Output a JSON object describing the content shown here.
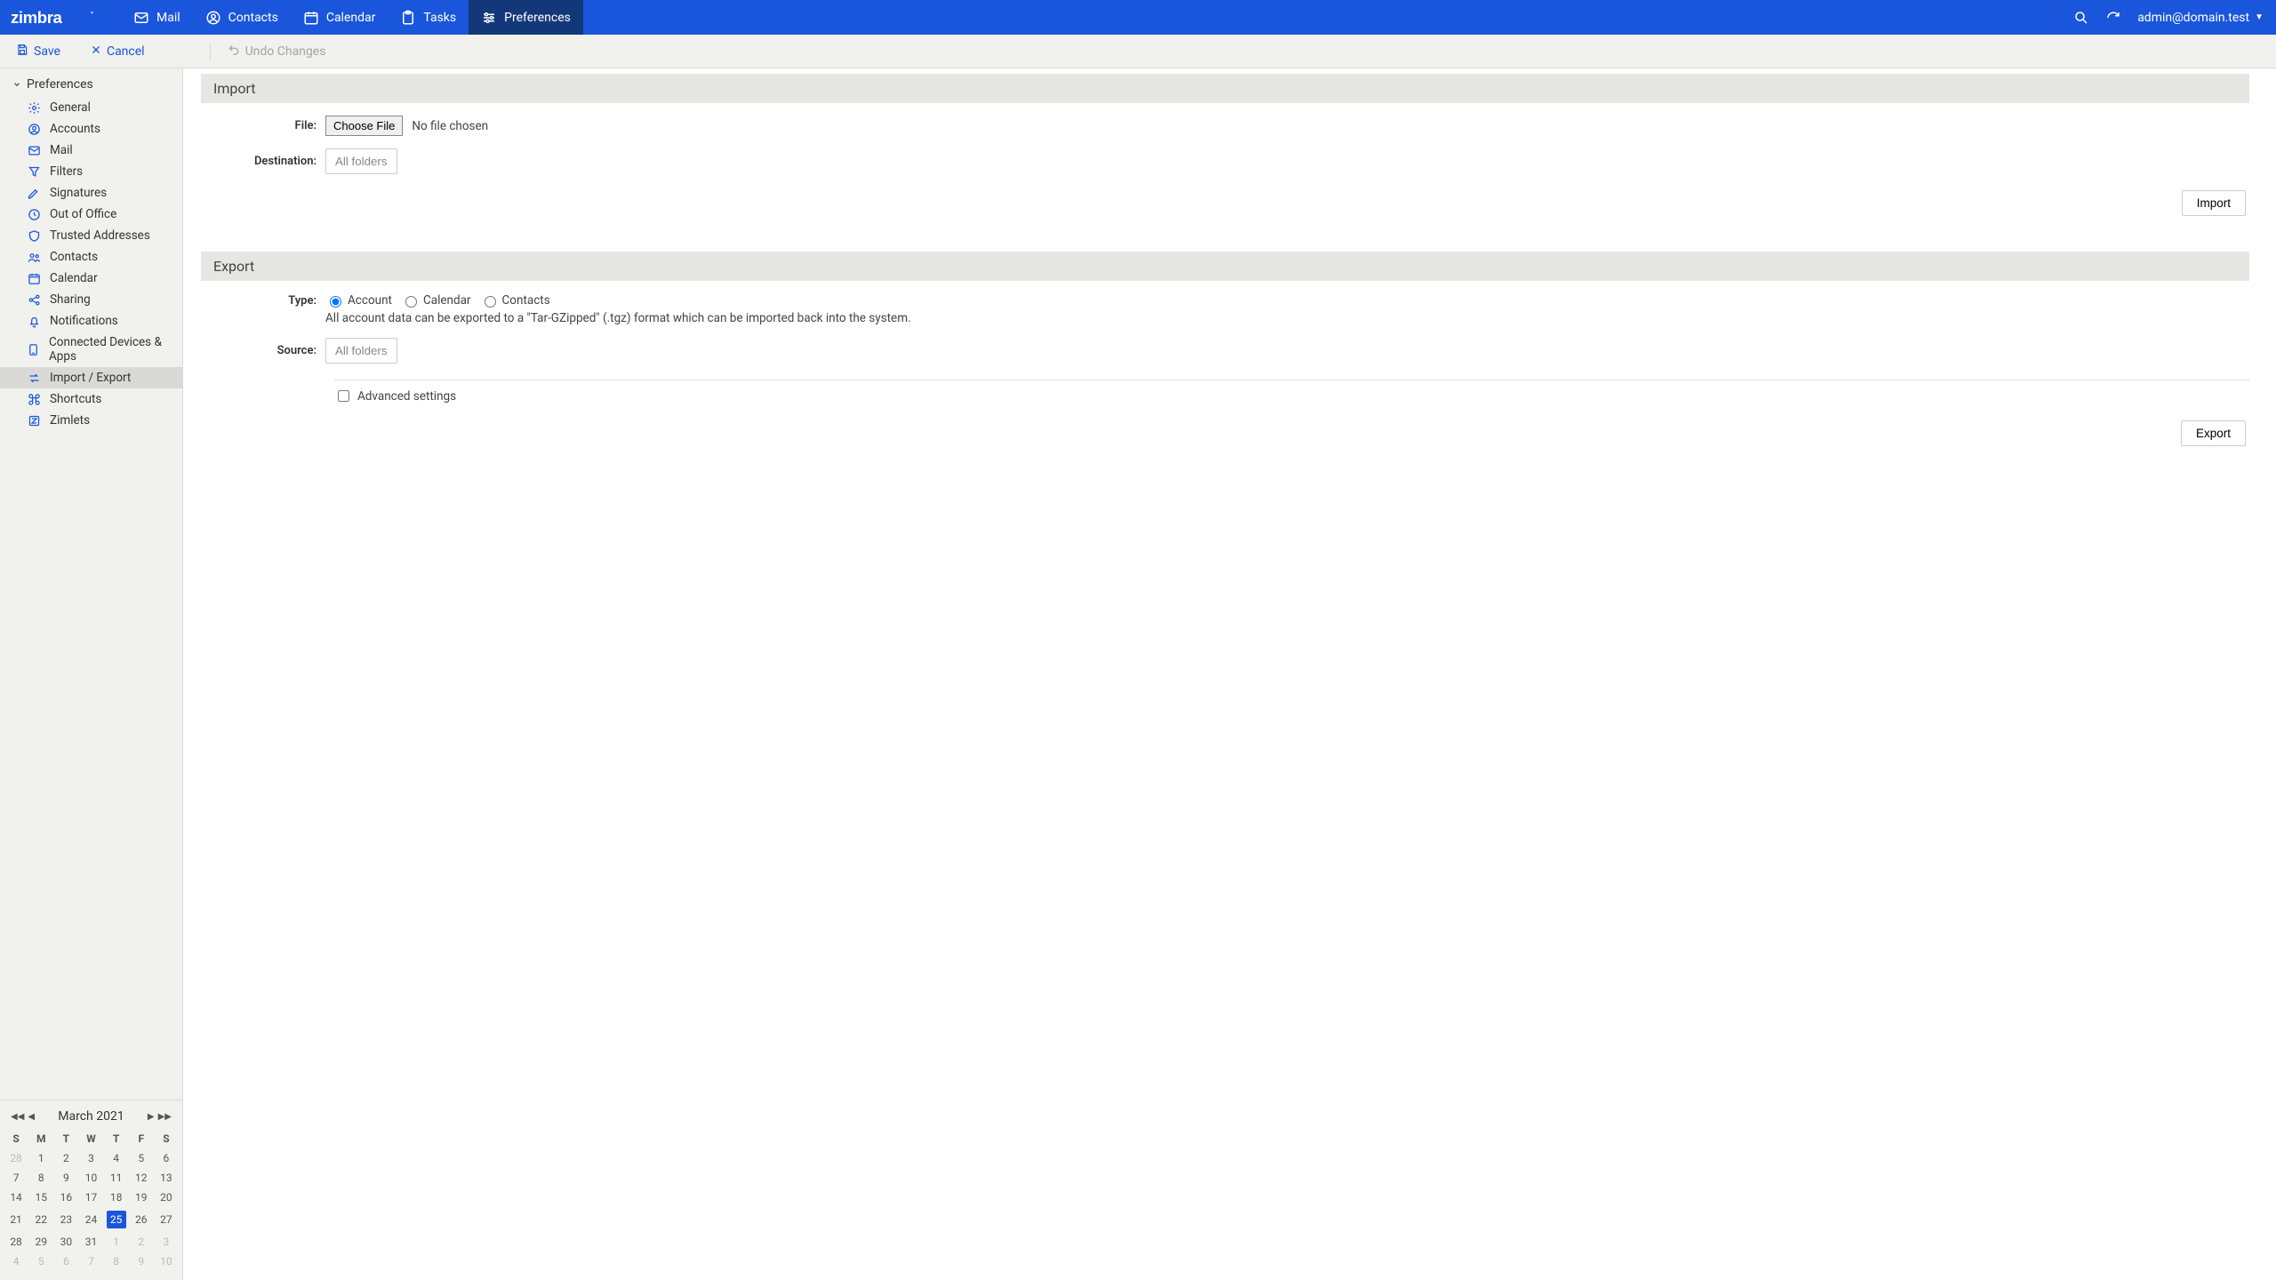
{
  "brand": "zimbra",
  "user": "admin@domain.test",
  "topbar_tabs": {
    "mail": "Mail",
    "contacts": "Contacts",
    "calendar": "Calendar",
    "tasks": "Tasks",
    "preferences": "Preferences"
  },
  "toolbar": {
    "save": "Save",
    "cancel": "Cancel",
    "undo": "Undo Changes"
  },
  "sidebar": {
    "header": "Preferences",
    "items": {
      "general": "General",
      "accounts": "Accounts",
      "mail": "Mail",
      "filters": "Filters",
      "signatures": "Signatures",
      "outofoffice": "Out of Office",
      "trusted": "Trusted Addresses",
      "contacts": "Contacts",
      "calendar": "Calendar",
      "sharing": "Sharing",
      "notifications": "Notifications",
      "devices": "Connected Devices & Apps",
      "importexport": "Import / Export",
      "shortcuts": "Shortcuts",
      "zimlets": "Zimlets"
    }
  },
  "minical": {
    "title": "March 2021",
    "dow": [
      "S",
      "M",
      "T",
      "W",
      "T",
      "F",
      "S"
    ],
    "weeks": [
      [
        {
          "d": "28",
          "o": true
        },
        {
          "d": "1"
        },
        {
          "d": "2"
        },
        {
          "d": "3"
        },
        {
          "d": "4"
        },
        {
          "d": "5"
        },
        {
          "d": "6"
        }
      ],
      [
        {
          "d": "7"
        },
        {
          "d": "8"
        },
        {
          "d": "9"
        },
        {
          "d": "10"
        },
        {
          "d": "11"
        },
        {
          "d": "12"
        },
        {
          "d": "13"
        }
      ],
      [
        {
          "d": "14"
        },
        {
          "d": "15"
        },
        {
          "d": "16"
        },
        {
          "d": "17"
        },
        {
          "d": "18"
        },
        {
          "d": "19"
        },
        {
          "d": "20"
        }
      ],
      [
        {
          "d": "21"
        },
        {
          "d": "22"
        },
        {
          "d": "23"
        },
        {
          "d": "24"
        },
        {
          "d": "25",
          "t": true
        },
        {
          "d": "26"
        },
        {
          "d": "27"
        }
      ],
      [
        {
          "d": "28"
        },
        {
          "d": "29"
        },
        {
          "d": "30"
        },
        {
          "d": "31"
        },
        {
          "d": "1",
          "o": true
        },
        {
          "d": "2",
          "o": true
        },
        {
          "d": "3",
          "o": true
        }
      ],
      [
        {
          "d": "4",
          "o": true
        },
        {
          "d": "5",
          "o": true
        },
        {
          "d": "6",
          "o": true
        },
        {
          "d": "7",
          "o": true
        },
        {
          "d": "8",
          "o": true
        },
        {
          "d": "9",
          "o": true
        },
        {
          "d": "10",
          "o": true
        }
      ]
    ]
  },
  "content": {
    "import": {
      "title": "Import",
      "file_label": "File:",
      "choose_btn": "Choose File",
      "no_file": "No file chosen",
      "dest_label": "Destination:",
      "dest_value": "All folders",
      "action": "Import"
    },
    "export": {
      "title": "Export",
      "type_label": "Type:",
      "radio_account": "Account",
      "radio_calendar": "Calendar",
      "radio_contacts": "Contacts",
      "type_desc": "All account data can be exported to a \"Tar-GZipped\" (.tgz) format which can be imported back into the system.",
      "source_label": "Source:",
      "source_value": "All folders",
      "advanced": "Advanced settings",
      "action": "Export"
    }
  }
}
